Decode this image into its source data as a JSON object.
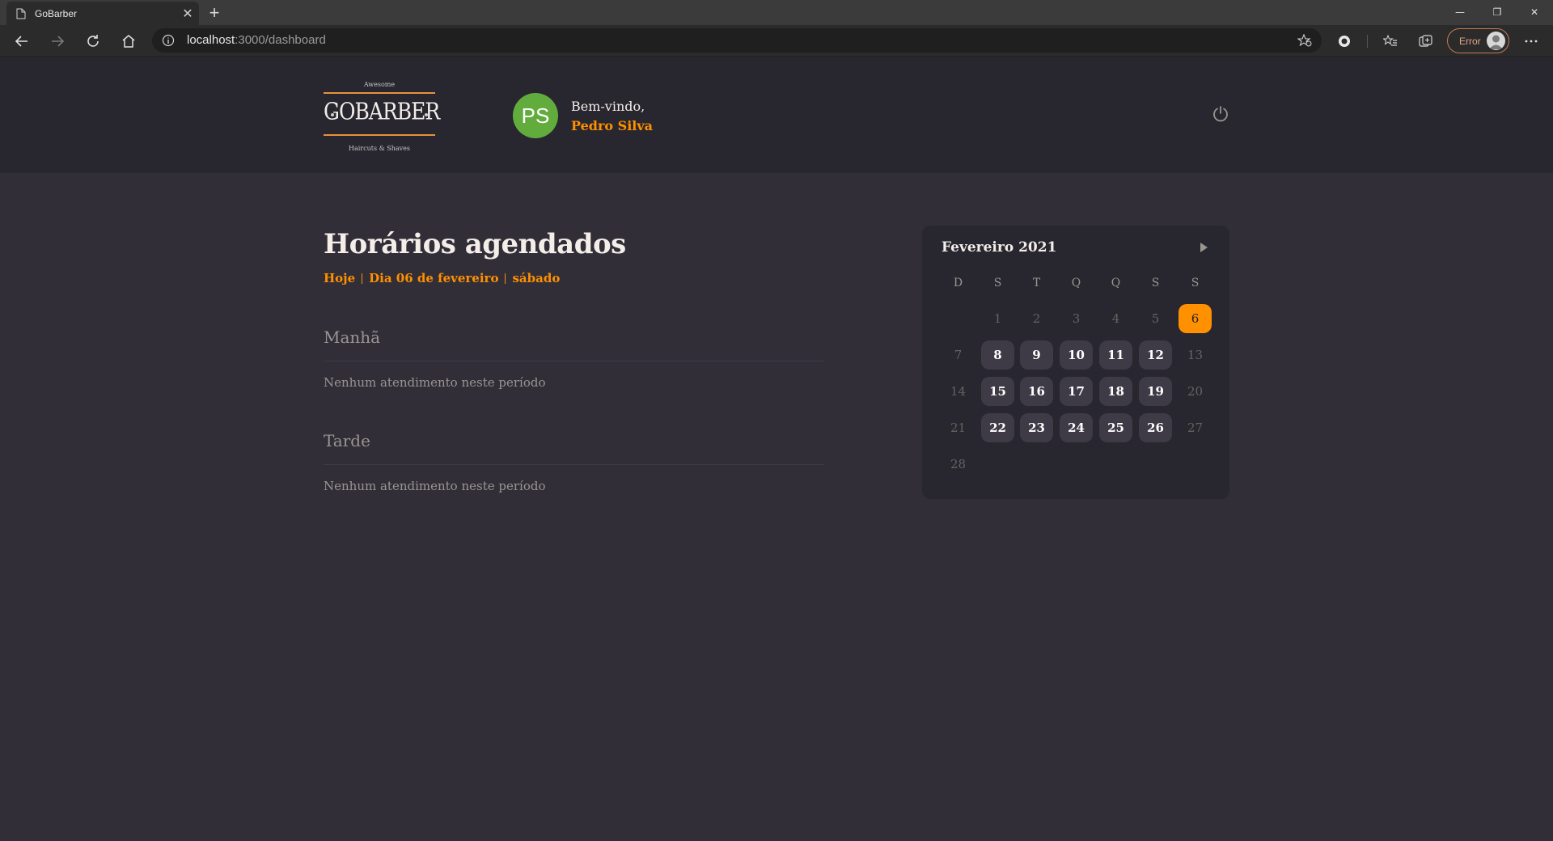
{
  "browser": {
    "tab_title": "GoBarber",
    "url_host": "localhost",
    "url_path": ":3000/dashboard",
    "error_label": "Error"
  },
  "header": {
    "logo_top": "Awesome",
    "logo_brand": "GOBARBER",
    "logo_bottom": "Haircuts & Shaves",
    "avatar_initials": "PS",
    "welcome": "Bem-vindo,",
    "username": "Pedro Silva"
  },
  "schedule": {
    "title": "Horários agendados",
    "today": "Hoje",
    "date": "Dia 06 de fevereiro",
    "weekday": "sábado",
    "sections": [
      {
        "title": "Manhã",
        "empty": "Nenhum atendimento neste período"
      },
      {
        "title": "Tarde",
        "empty": "Nenhum atendimento neste período"
      }
    ]
  },
  "calendar": {
    "month": "Fevereiro 2021",
    "weekdays": [
      "D",
      "S",
      "T",
      "Q",
      "Q",
      "S",
      "S"
    ],
    "weeks": [
      [
        "",
        "1",
        "2",
        "3",
        "4",
        "5",
        "6"
      ],
      [
        "7",
        "8",
        "9",
        "10",
        "11",
        "12",
        "13"
      ],
      [
        "14",
        "15",
        "16",
        "17",
        "18",
        "19",
        "20"
      ],
      [
        "21",
        "22",
        "23",
        "24",
        "25",
        "26",
        "27"
      ],
      [
        "28",
        "",
        "",
        "",
        "",
        "",
        ""
      ]
    ],
    "selected_day": "6",
    "available_days": [
      "8",
      "9",
      "10",
      "11",
      "12",
      "15",
      "16",
      "17",
      "18",
      "19",
      "22",
      "23",
      "24",
      "25",
      "26"
    ]
  },
  "colors": {
    "accent": "#ff9000",
    "background": "#312e38",
    "header_bg": "#28262e",
    "avatar": "#62ac3e"
  }
}
